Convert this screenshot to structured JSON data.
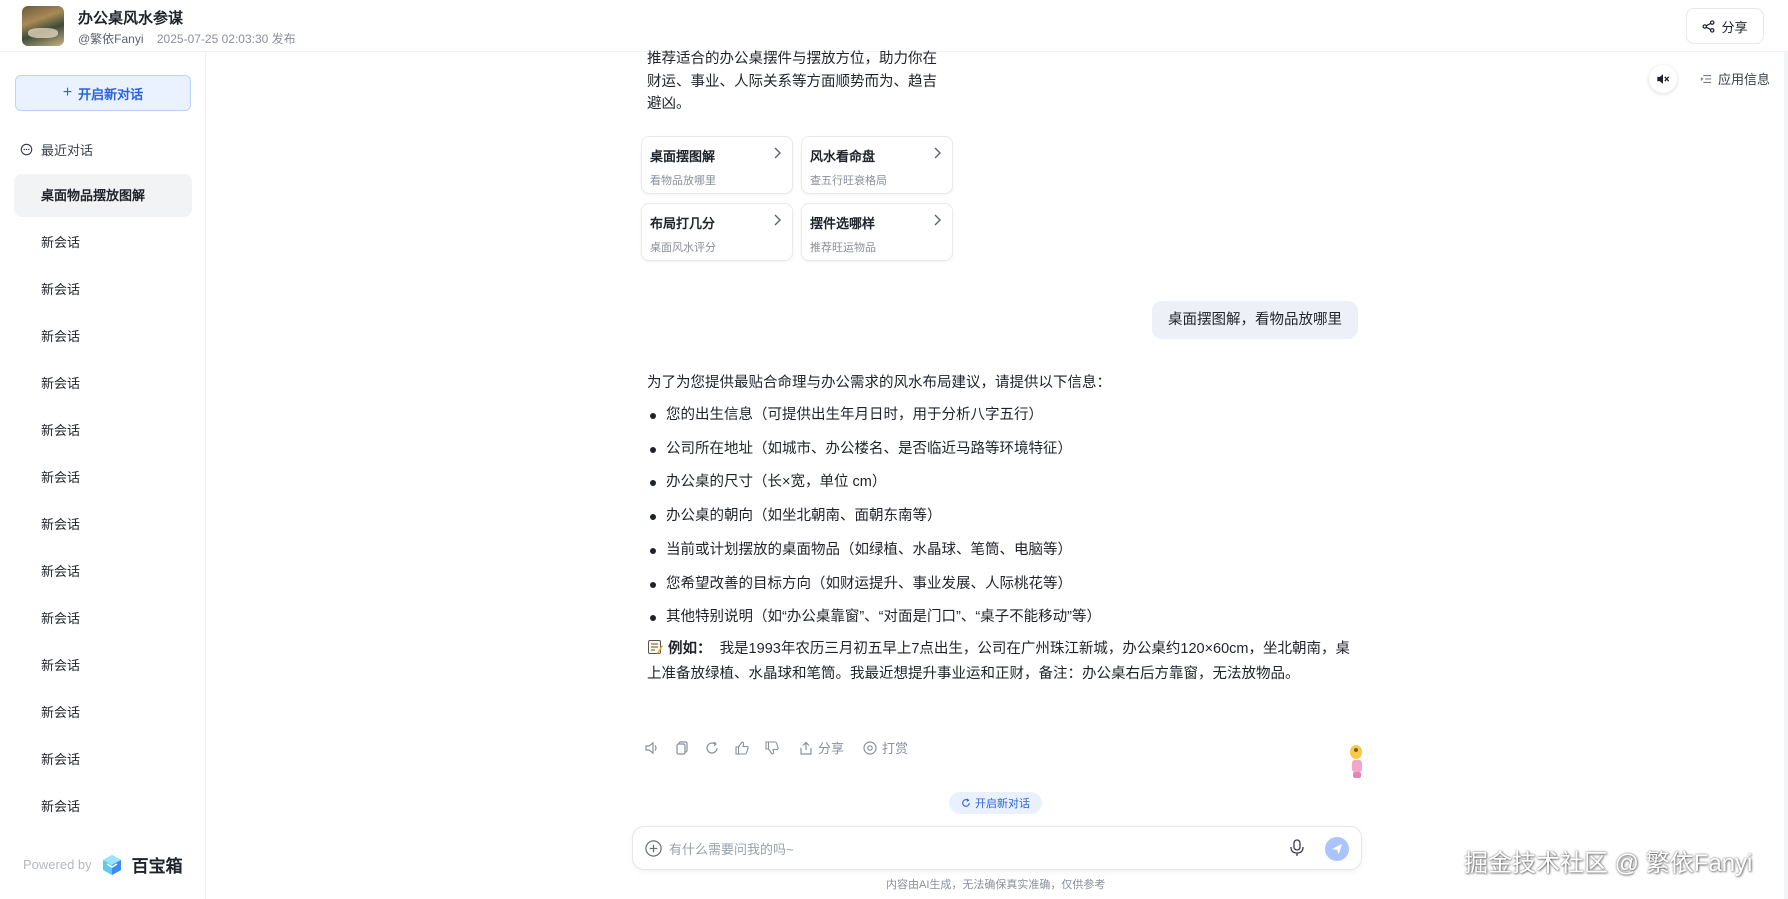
{
  "header": {
    "title": "办公桌风水参谋",
    "author": "@繁依Fanyi",
    "published": "2025-07-25 02:03:30 发布",
    "share_label": "分享"
  },
  "sidebar": {
    "new_chat_label": "开启新对话",
    "recent_label": "最近对话",
    "items": [
      {
        "label": "桌面物品摆放图解",
        "active": true
      },
      {
        "label": "新会话"
      },
      {
        "label": "新会话"
      },
      {
        "label": "新会话"
      },
      {
        "label": "新会话"
      },
      {
        "label": "新会话"
      },
      {
        "label": "新会话"
      },
      {
        "label": "新会话"
      },
      {
        "label": "新会话"
      },
      {
        "label": "新会话"
      },
      {
        "label": "新会话"
      },
      {
        "label": "新会话"
      },
      {
        "label": "新会话"
      },
      {
        "label": "新会话"
      }
    ],
    "powered_by": "Powered by",
    "brand": "百宝箱"
  },
  "chat": {
    "intro_text": "推荐适合的办公桌摆件与摆放方位，助力你在财运、事业、人际关系等方面顺势而为、趋吉避凶。",
    "suggestions": [
      {
        "title": "桌面摆图解",
        "subtitle": "看物品放哪里"
      },
      {
        "title": "风水看命盘",
        "subtitle": "查五行旺衰格局"
      },
      {
        "title": "布局打几分",
        "subtitle": "桌面风水评分"
      },
      {
        "title": "摆件选哪样",
        "subtitle": "推荐旺运物品"
      }
    ],
    "user_message": "桌面摆图解，看物品放哪里",
    "answer": {
      "lead": "为了为您提供最贴合命理与办公需求的风水布局建议，请提供以下信息：",
      "items": [
        "您的出生信息（可提供出生年月日时，用于分析八字五行）",
        "公司所在地址（如城市、办公楼名、是否临近马路等环境特征）",
        "办公桌的尺寸（长×宽，单位 cm）",
        "办公桌的朝向（如坐北朝南、面朝东南等）",
        "当前或计划摆放的桌面物品（如绿植、水晶球、笔筒、电脑等）",
        "您希望改善的目标方向（如财运提升、事业发展、人际桃花等）",
        "其他特别说明（如“办公桌靠窗”、“对面是门口”、“桌子不能移动”等）"
      ],
      "example_label": "例如：",
      "example_text": "我是1993年农历三月初五早上7点出生，公司在广州珠江新城，办公桌约120×60cm，坐北朝南，桌上准备放绿植、水晶球和笔筒。我最近想提升事业运和正财，备注：办公桌右后方靠窗，无法放物品。"
    },
    "actions": {
      "share_label": "分享",
      "tip_label": "打赏"
    },
    "new_chat_pill": "开启新对话",
    "input_placeholder": "有什么需要问我的吗~",
    "disclaimer": "内容由AI生成，无法确保真实准确，仅供参考",
    "app_info_label": "应用信息"
  },
  "watermark": "掘金技术社区 @ 繁依Fanyi",
  "colors": {
    "accent": "#2b63e6",
    "accent_light": "#eaf2ff",
    "send_button": "#a9c4ff"
  }
}
